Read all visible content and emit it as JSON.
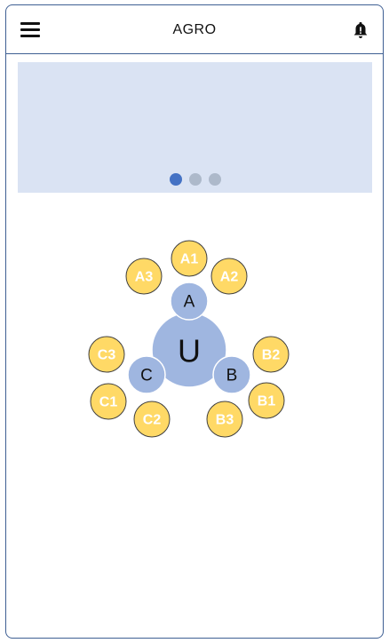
{
  "app": {
    "title": "AGRO"
  },
  "icons": {
    "menu": "hamburger-menu-icon",
    "notifications": "bell-icon"
  },
  "carousel": {
    "slide_count": 3,
    "active_index": 0
  },
  "colors": {
    "frame": "#3e5f93",
    "banner": "#dae3f3",
    "hub": "#9fb6e0",
    "leaf": "#ffd966",
    "dot_active": "#4472c4",
    "dot_inactive": "#adb9ca"
  },
  "diagram": {
    "center": "U",
    "groups": [
      {
        "label": "A",
        "children": [
          "A1",
          "A2",
          "A3"
        ]
      },
      {
        "label": "B",
        "children": [
          "B1",
          "B2",
          "B3"
        ]
      },
      {
        "label": "C",
        "children": [
          "C1",
          "C2",
          "C3"
        ]
      }
    ]
  }
}
